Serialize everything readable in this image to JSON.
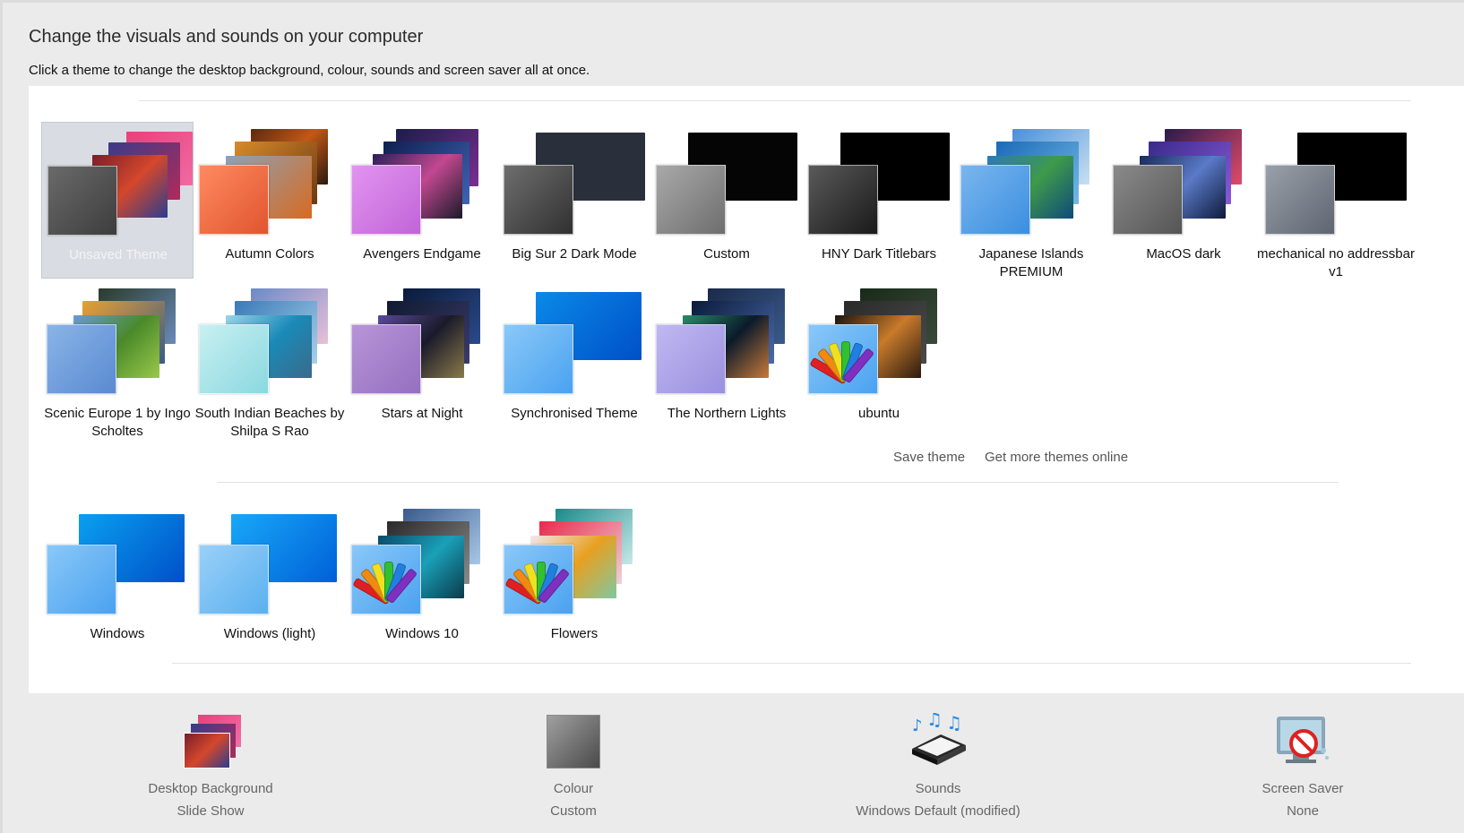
{
  "header": {
    "title": "Change the visuals and sounds on your computer",
    "subtitle": "Click a theme to change the desktop background, colour, sounds and screen saver all at once."
  },
  "my_themes": [
    {
      "name": "Unsaved Theme",
      "selected": true
    },
    {
      "name": "Autumn Colors"
    },
    {
      "name": "Avengers Endgame"
    },
    {
      "name": "Big Sur 2 Dark Mode"
    },
    {
      "name": "Custom"
    },
    {
      "name": "HNY Dark Titlebars"
    },
    {
      "name": "Japanese Islands PREMIUM"
    },
    {
      "name": "MacOS dark"
    },
    {
      "name": "mechanical no addressbar v1"
    },
    {
      "name": "Scenic Europe 1 by Ingo Scholtes"
    },
    {
      "name": "South Indian Beaches by Shilpa S Rao"
    },
    {
      "name": "Stars at Night"
    },
    {
      "name": "Synchronised Theme"
    },
    {
      "name": "The Northern Lights"
    },
    {
      "name": "ubuntu"
    }
  ],
  "links": {
    "save_theme": "Save theme",
    "get_more": "Get more themes online"
  },
  "windows_themes": [
    {
      "name": "Windows"
    },
    {
      "name": "Windows (light)"
    },
    {
      "name": "Windows 10"
    },
    {
      "name": "Flowers"
    }
  ],
  "bottom": {
    "desktop_background": {
      "label": "Desktop Background",
      "value": "Slide Show"
    },
    "colour": {
      "label": "Colour",
      "value": "Custom"
    },
    "sounds": {
      "label": "Sounds",
      "value": "Windows Default (modified)"
    },
    "screen_saver": {
      "label": "Screen Saver",
      "value": "None"
    }
  },
  "colors": {
    "selection": "#d9dde3",
    "window_bg": "#ebebeb",
    "panel_bg": "#ffffff"
  }
}
